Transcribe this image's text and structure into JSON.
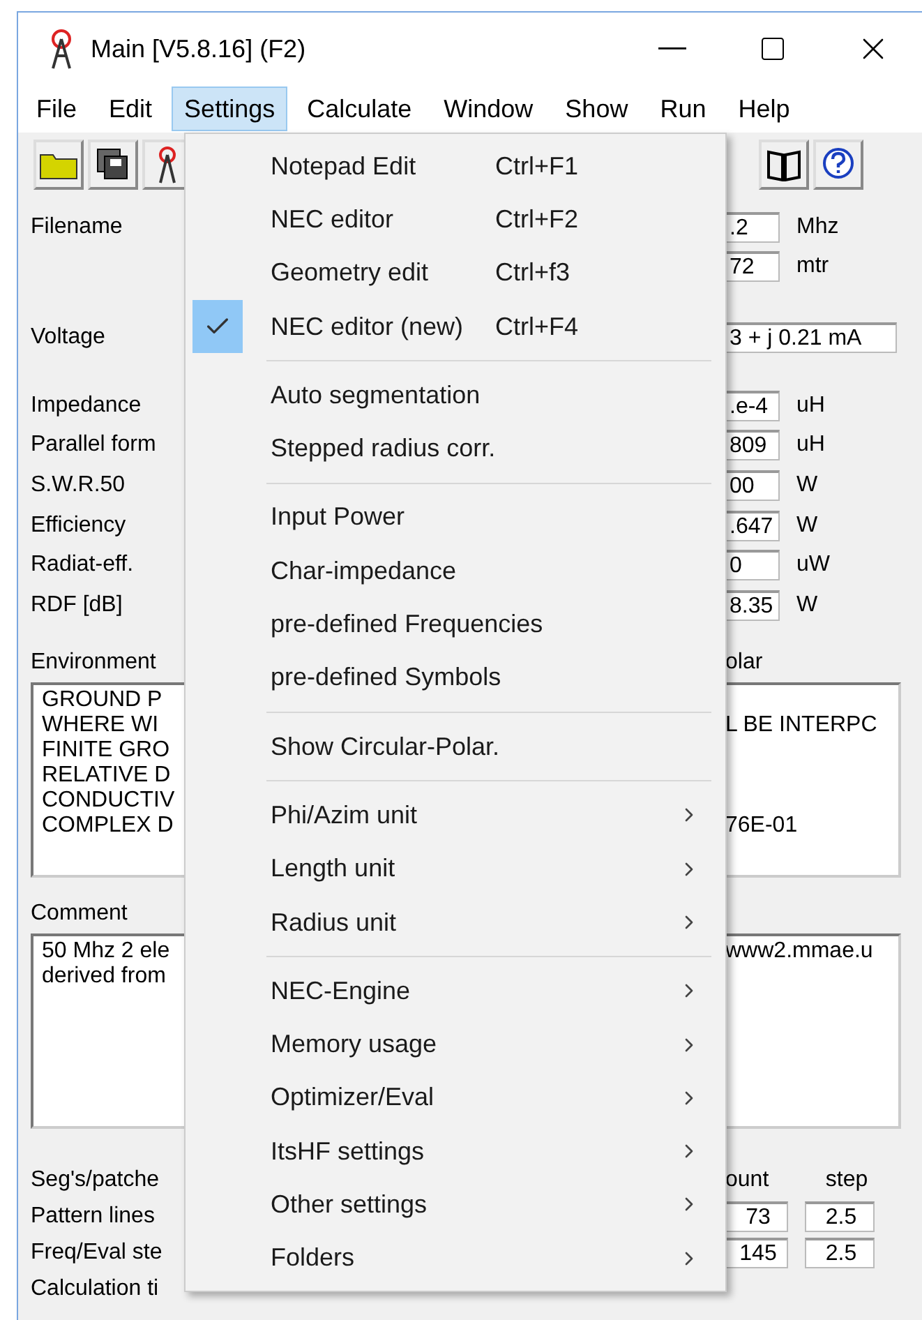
{
  "window": {
    "title": "Main [V5.8.16]  (F2)"
  },
  "menubar": [
    {
      "label": "File",
      "selected": false
    },
    {
      "label": "Edit",
      "selected": false
    },
    {
      "label": "Settings",
      "selected": true
    },
    {
      "label": "Calculate",
      "selected": false
    },
    {
      "label": "Window",
      "selected": false
    },
    {
      "label": "Show",
      "selected": false
    },
    {
      "label": "Run",
      "selected": false
    },
    {
      "label": "Help",
      "selected": false
    }
  ],
  "form": {
    "groups": [
      [
        {
          "label": "Filename",
          "value": ".2",
          "unit": "Mhz"
        },
        {
          "value": "72",
          "unit": "mtr"
        }
      ],
      [
        {
          "label": "Voltage",
          "value": "3 + j 0.21 mA",
          "kind": "wide"
        }
      ],
      [
        {
          "label": "Impedance",
          "value": ".e-4",
          "unit": "uH"
        },
        {
          "label": "Parallel form",
          "value": "809",
          "unit": "uH"
        },
        {
          "label": "S.W.R.50",
          "value": "00",
          "unit": "W"
        },
        {
          "label": "Efficiency",
          "value": ".647",
          "unit": "W"
        },
        {
          "label": "Radiat-eff.",
          "value": "0",
          "unit": "uW"
        },
        {
          "label": "RDF [dB]",
          "value": "8.35",
          "unit": "W"
        }
      ]
    ],
    "environment": {
      "label": "Environment",
      "right_label": "olar",
      "lines": [
        {
          "left": "GROUND P"
        },
        {
          "left": "WHERE WI",
          "right": "L BE INTERPC"
        },
        {
          "left": "FINITE GRO"
        },
        {
          "left": "RELATIVE D"
        },
        {
          "left": "CONDUCTIV"
        },
        {
          "left": "COMPLEX D",
          "right": "76E-01"
        }
      ]
    },
    "comment": {
      "label": "Comment",
      "left_lines": [
        "50 Mhz 2 ele",
        "derived from"
      ],
      "right_lines": [
        "www2.mmae.u"
      ]
    },
    "bottom": {
      "headers": [
        "ount",
        "step"
      ],
      "rows": [
        {
          "label": "Seg's/patche"
        },
        {
          "label": "Pattern lines",
          "count": "73",
          "step": "2.5"
        },
        {
          "label": "Freq/Eval ste",
          "count": "145",
          "step": "2.5"
        },
        {
          "label": "Calculation ti"
        }
      ]
    }
  },
  "menu": {
    "sections": [
      [
        {
          "label": "Notepad Edit",
          "shortcut": "Ctrl+F1",
          "checked": false
        },
        {
          "label": "NEC editor",
          "shortcut": "Ctrl+F2",
          "checked": false
        },
        {
          "label": "Geometry edit",
          "shortcut": "Ctrl+f3",
          "checked": false
        },
        {
          "label": "NEC editor (new)",
          "shortcut": "Ctrl+F4",
          "checked": true
        }
      ],
      [
        {
          "label": "Auto segmentation",
          "checked": false
        },
        {
          "label": "Stepped radius corr.",
          "checked": false
        }
      ],
      [
        {
          "label": "Input Power",
          "checked": false
        },
        {
          "label": "Char-impedance",
          "checked": false
        },
        {
          "label": "pre-defined Frequencies",
          "checked": false
        },
        {
          "label": "pre-defined Symbols",
          "checked": false
        }
      ],
      [
        {
          "label": "Show Circular-Polar.",
          "checked": false
        }
      ],
      [
        {
          "label": "Phi/Azim unit",
          "submenu": true,
          "checked": false
        },
        {
          "label": "Length unit",
          "submenu": true,
          "checked": false
        },
        {
          "label": "Radius unit",
          "submenu": true,
          "checked": false
        }
      ],
      [
        {
          "label": "NEC-Engine",
          "submenu": true,
          "checked": false
        },
        {
          "label": "Memory usage",
          "submenu": true,
          "checked": false
        },
        {
          "label": "Optimizer/Eval",
          "submenu": true,
          "checked": false
        },
        {
          "label": "ItsHF settings",
          "submenu": true,
          "checked": false
        },
        {
          "label": "Other settings",
          "submenu": true,
          "checked": false
        },
        {
          "label": "Folders",
          "submenu": true,
          "checked": false
        }
      ]
    ]
  }
}
